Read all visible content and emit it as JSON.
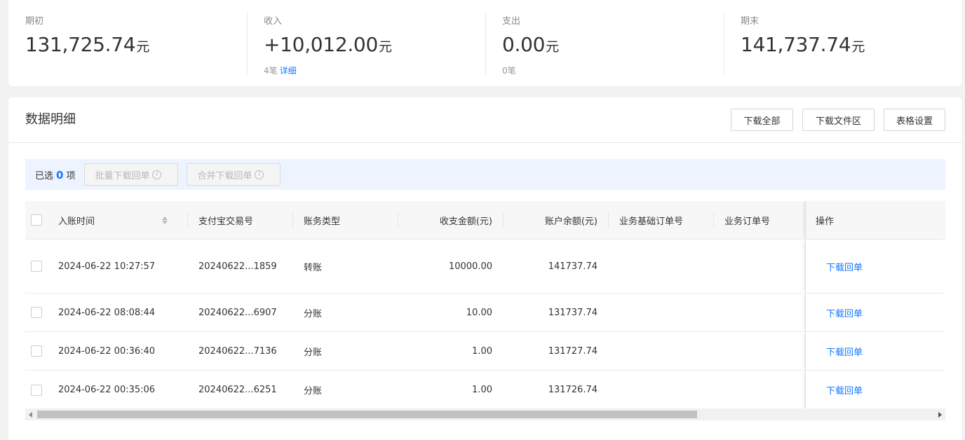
{
  "summary": [
    {
      "label": "期初",
      "value": "131,725.74",
      "unit": "元",
      "sub_count": "",
      "sub_link": ""
    },
    {
      "label": "收入",
      "value": "+10,012.00",
      "unit": "元",
      "sub_count": "4笔",
      "sub_link": "详细"
    },
    {
      "label": "支出",
      "value": "0.00",
      "unit": "元",
      "sub_count": "0笔",
      "sub_link": ""
    },
    {
      "label": "期末",
      "value": "141,737.74",
      "unit": "元",
      "sub_count": "",
      "sub_link": ""
    }
  ],
  "detail": {
    "title": "数据明细",
    "buttons": {
      "download_all": "下载全部",
      "file_area": "下载文件区",
      "table_settings": "表格设置"
    }
  },
  "selection": {
    "prefix": "已选",
    "count": "0",
    "suffix": "项",
    "batch_download": "批量下载回单",
    "merge_download": "合并下载回单"
  },
  "table": {
    "headers": {
      "time": "入账时间",
      "trade_no": "支付宝交易号",
      "type": "账务类型",
      "amount": "收支金额(元)",
      "balance": "账户余额(元)",
      "base_order": "业务基础订单号",
      "order": "业务订单号",
      "action": "操作"
    },
    "rows": [
      {
        "time": "2024-06-22 10:27:57",
        "trade_no": "20240622...1859",
        "type": "转账",
        "amount": "10000.00",
        "balance": "141737.74",
        "base_order": "",
        "order": "",
        "action": "下载回单"
      },
      {
        "time": "2024-06-22 08:08:44",
        "trade_no": "20240622...6907",
        "type": "分账",
        "amount": "10.00",
        "balance": "131737.74",
        "base_order": "",
        "order": "",
        "action": "下载回单"
      },
      {
        "time": "2024-06-22 00:36:40",
        "trade_no": "20240622...7136",
        "type": "分账",
        "amount": "1.00",
        "balance": "131727.74",
        "base_order": "",
        "order": "",
        "action": "下载回单"
      },
      {
        "time": "2024-06-22 00:35:06",
        "trade_no": "20240622...6251",
        "type": "分账",
        "amount": "1.00",
        "balance": "131726.74",
        "base_order": "",
        "order": "",
        "action": "下载回单"
      }
    ]
  },
  "colors": {
    "accent": "#1677ff",
    "selection_bar": "#eef4ff",
    "page_bg": "#f2f2f2"
  }
}
